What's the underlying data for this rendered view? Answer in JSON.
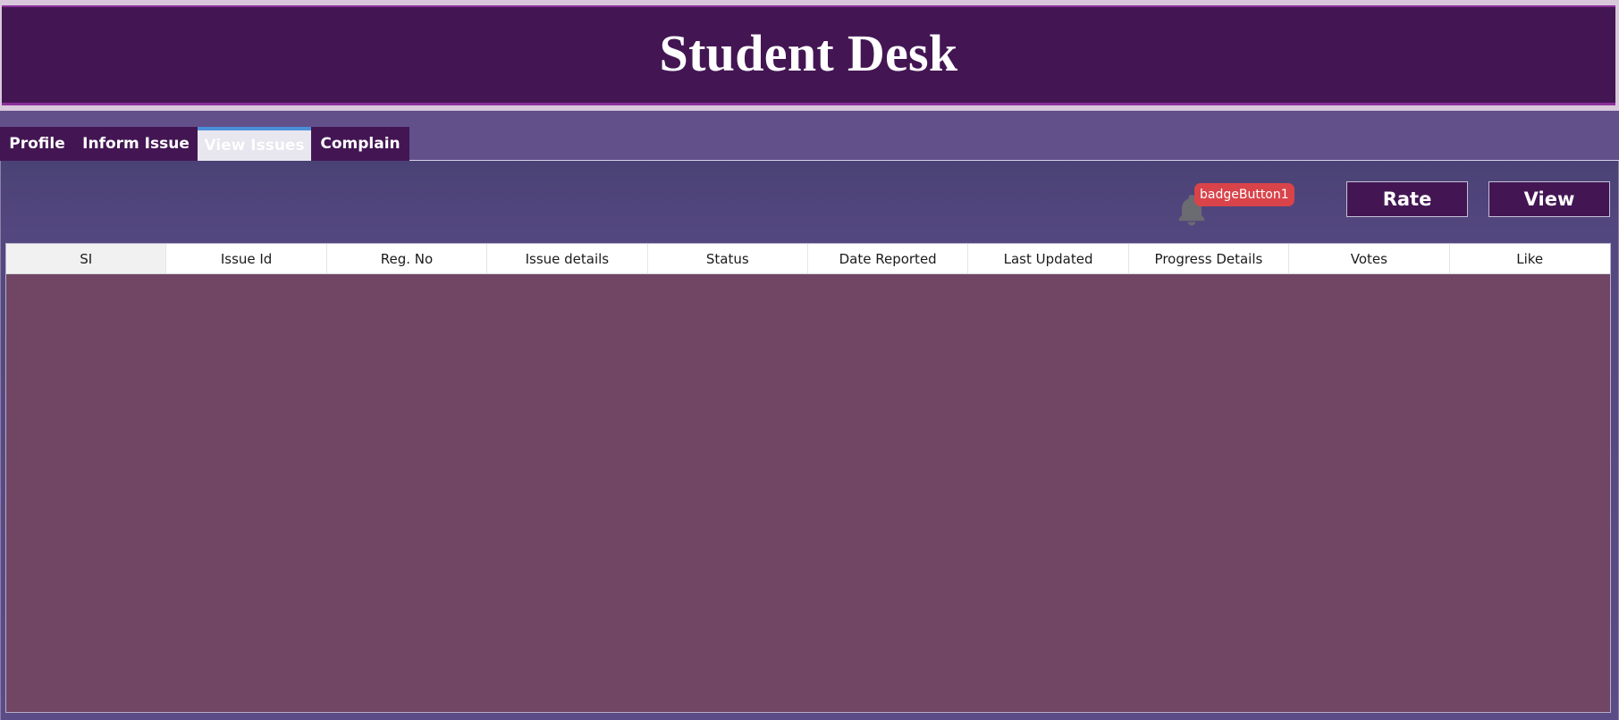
{
  "header": {
    "title": "Student Desk"
  },
  "tabs": [
    {
      "label": "Profile",
      "active": false
    },
    {
      "label": "Inform Issue",
      "active": false
    },
    {
      "label": "View Issues",
      "active": true
    },
    {
      "label": "Complain",
      "active": false
    }
  ],
  "notification": {
    "icon": "bell-icon",
    "badge_label": "badgeButton1"
  },
  "actions": {
    "rate_label": "Rate",
    "view_label": "View"
  },
  "grid": {
    "columns": [
      "SI",
      "Issue Id",
      "Reg. No",
      "Issue details",
      "Status",
      "Date Reported",
      "Last Updated",
      "Progress Details",
      "Votes",
      "Like"
    ],
    "rows": []
  },
  "colors": {
    "header_bg": "#431653",
    "accent": "#4b8fd9",
    "grid_body": "#704664",
    "badge": "#d9434a"
  }
}
